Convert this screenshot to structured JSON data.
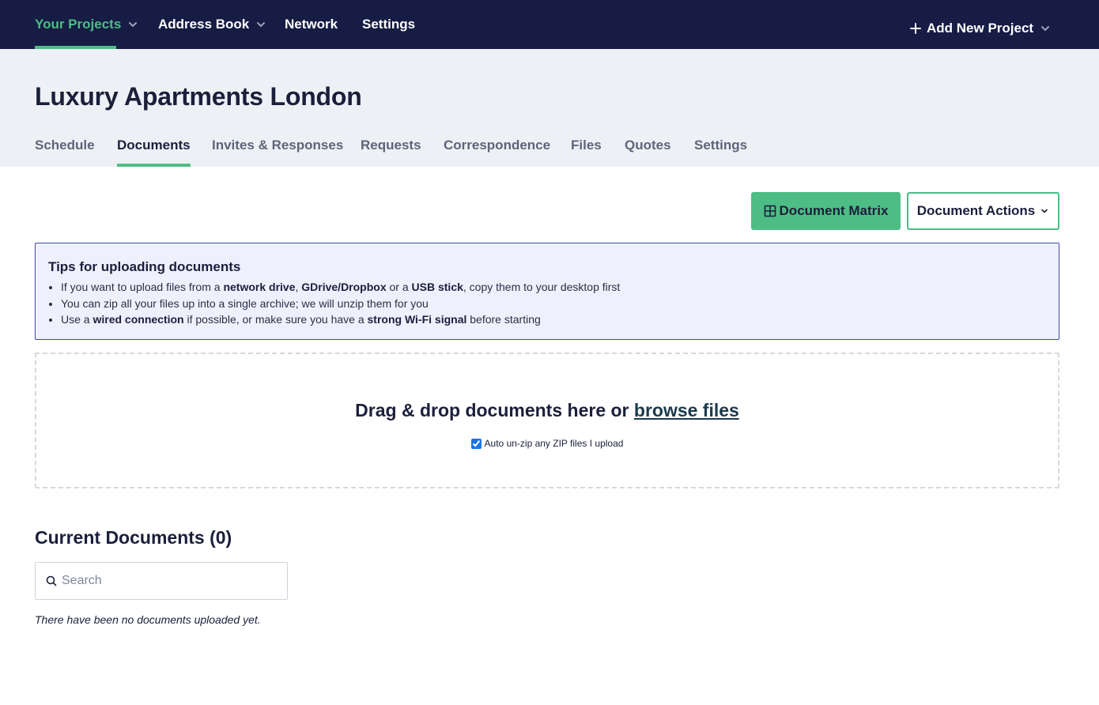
{
  "topnav": {
    "items": [
      {
        "label": "Your Projects",
        "active": true,
        "dropdown": true
      },
      {
        "label": "Address Book",
        "active": false,
        "dropdown": true
      },
      {
        "label": "Network",
        "active": false,
        "dropdown": false
      },
      {
        "label": "Settings",
        "active": false,
        "dropdown": false
      }
    ],
    "add_project_label": "Add New Project"
  },
  "project": {
    "title": "Luxury Apartments London"
  },
  "tabs": [
    {
      "label": "Schedule",
      "active": false
    },
    {
      "label": "Documents",
      "active": true
    },
    {
      "label": "Invites & Responses",
      "active": false
    },
    {
      "label": "Requests",
      "active": false
    },
    {
      "label": "Correspondence",
      "active": false
    },
    {
      "label": "Files",
      "active": false
    },
    {
      "label": "Quotes",
      "active": false
    },
    {
      "label": "Settings",
      "active": false
    }
  ],
  "actions": {
    "matrix_label": "Document Matrix",
    "actions_label": "Document Actions"
  },
  "tips": {
    "title": "Tips for uploading documents",
    "line1": {
      "t1": "If you want to upload files from a ",
      "b1": "network drive",
      "t2": ", ",
      "b2": "GDrive/Dropbox",
      "t3": " or a ",
      "b3": "USB stick",
      "t4": ", copy them to your desktop first"
    },
    "line2": "You can zip all your files up into a single archive; we will unzip them for you",
    "line3": {
      "t1": "Use a ",
      "b1": "wired connection",
      "t2": " if possible, or make sure you have a ",
      "b2": "strong Wi-Fi signal",
      "t3": " before starting"
    }
  },
  "dropzone": {
    "text": "Drag & drop documents here or ",
    "browse_link": "browse files",
    "unzip_label": "Auto un-zip any ZIP files I upload",
    "unzip_checked": true
  },
  "documents": {
    "heading": "Current Documents (0)",
    "search_placeholder": "Search",
    "empty_message": "There have been no documents uploaded yet."
  },
  "colors": {
    "nav_bg": "#161c44",
    "accent": "#4dbd85",
    "header_bg": "#edf1f6",
    "tips_bg": "#eef0fd",
    "tips_border": "#3d4aa8"
  },
  "icons": {
    "nav_dropdown": "chevron-down-icon",
    "add": "plus-icon",
    "matrix": "grid-icon",
    "search": "search-icon"
  }
}
